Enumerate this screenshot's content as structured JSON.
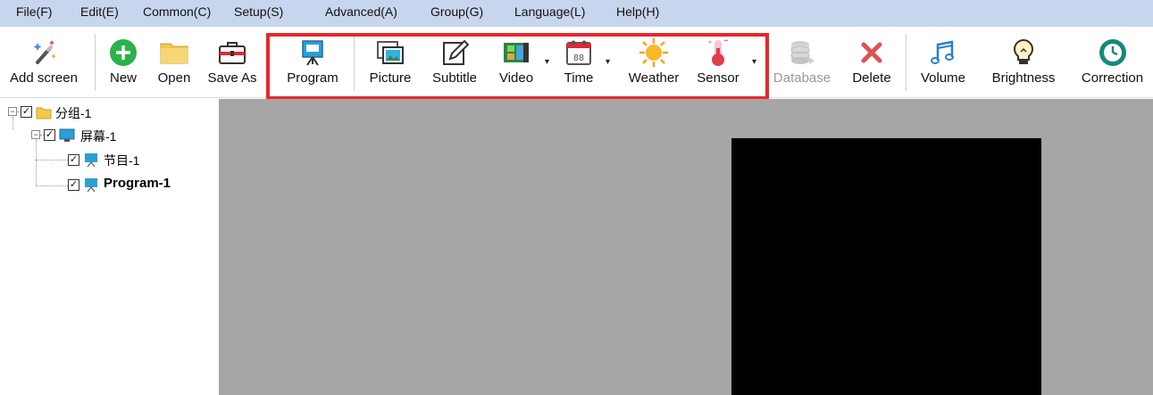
{
  "menu": [
    {
      "label": "File(F)"
    },
    {
      "label": "Edit(E)"
    },
    {
      "label": "Common(C)"
    },
    {
      "label": "Setup(S)"
    },
    {
      "label": "Advanced(A)"
    },
    {
      "label": "Group(G)"
    },
    {
      "label": "Language(L)"
    },
    {
      "label": "Help(H)"
    }
  ],
  "toolbar": {
    "add_screen": "Add screen",
    "new": "New",
    "open": "Open",
    "save_as": "Save As",
    "program": "Program",
    "picture": "Picture",
    "subtitle": "Subtitle",
    "video": "Video",
    "time": "Time",
    "weather": "Weather",
    "sensor": "Sensor",
    "database": "Database",
    "delete": "Delete",
    "volume": "Volume",
    "brightness": "Brightness",
    "correction": "Correction"
  },
  "tree": {
    "group": "分组-1",
    "screen": "屏幕-1",
    "program_cn": "节目-1",
    "program_en": "Program-1"
  },
  "colors": {
    "menubar": "#c7d6ee",
    "highlight_border": "#e8262d",
    "canvas": "#a6a6a6",
    "preview": "#000000",
    "new_icon": "#2cb24a",
    "folder": "#f2c94c"
  }
}
